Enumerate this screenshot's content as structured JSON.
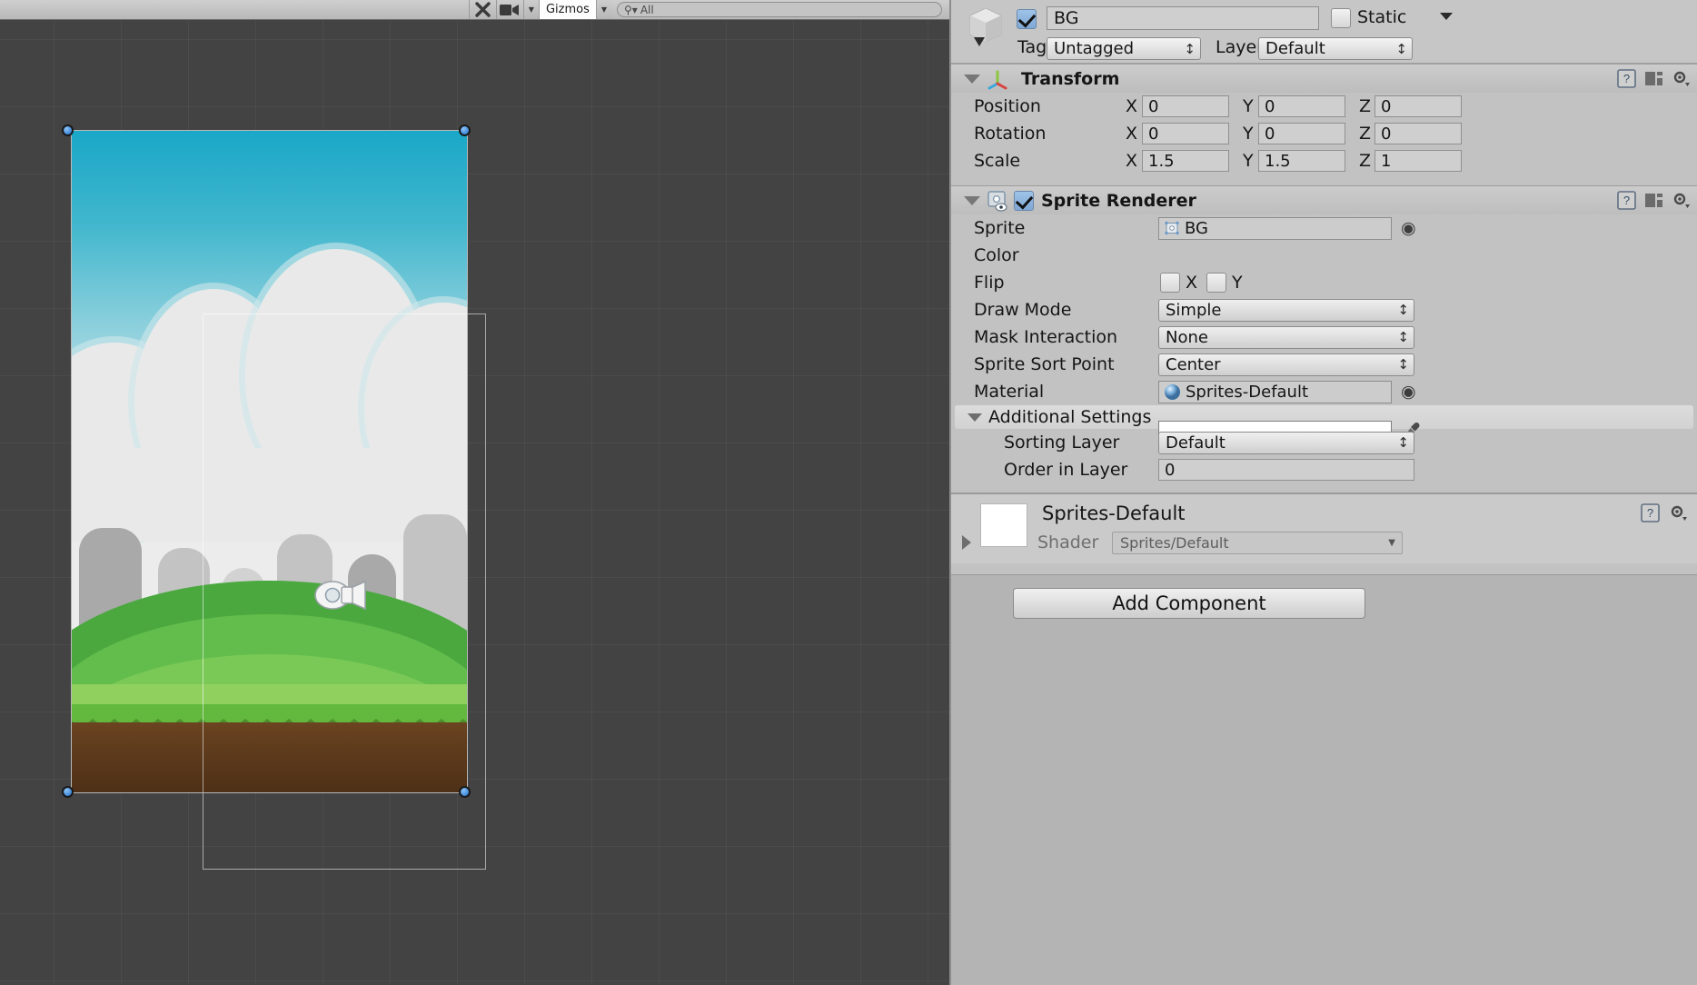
{
  "scene_toolbar": {
    "tools_icon": "tools-icon",
    "camera_icon": "camera-icon",
    "gizmos_label": "Gizmos",
    "search_placeholder": "All",
    "search_icon": "search-icon"
  },
  "scene": {
    "selected_object": "BG",
    "camera_gizmo": "camera-gizmo-icon"
  },
  "inspector": {
    "game_object": {
      "enabled": true,
      "name": "BG",
      "static_label": "Static",
      "static_checked": false,
      "tag_label": "Tag",
      "tag_value": "Untagged",
      "layer_label": "Layer",
      "layer_value": "Default"
    },
    "transform": {
      "title": "Transform",
      "icon": "transform-axis-icon",
      "rows": [
        {
          "label": "Position",
          "x": "0",
          "y": "0",
          "z": "0"
        },
        {
          "label": "Rotation",
          "x": "0",
          "y": "0",
          "z": "0"
        },
        {
          "label": "Scale",
          "x": "1.5",
          "y": "1.5",
          "z": "1"
        }
      ],
      "axis_labels": [
        "X",
        "Y",
        "Z"
      ]
    },
    "sprite_renderer": {
      "title": "Sprite Renderer",
      "enabled": true,
      "icon": "sprite-renderer-icon",
      "sprite_label": "Sprite",
      "sprite_value": "BG",
      "color_label": "Color",
      "color_value": "#FFFFFF",
      "flip_label": "Flip",
      "flip_x_label": "X",
      "flip_y_label": "Y",
      "flip_x": false,
      "flip_y": false,
      "draw_mode_label": "Draw Mode",
      "draw_mode_value": "Simple",
      "mask_interaction_label": "Mask Interaction",
      "mask_interaction_value": "None",
      "sprite_sort_point_label": "Sprite Sort Point",
      "sprite_sort_point_value": "Center",
      "material_label": "Material",
      "material_value": "Sprites-Default",
      "additional_settings_label": "Additional Settings",
      "sorting_layer_label": "Sorting Layer",
      "sorting_layer_value": "Default",
      "order_in_layer_label": "Order in Layer",
      "order_in_layer_value": "0"
    },
    "material_preview": {
      "name": "Sprites-Default",
      "shader_label": "Shader",
      "shader_value": "Sprites/Default"
    },
    "add_component_label": "Add Component"
  }
}
